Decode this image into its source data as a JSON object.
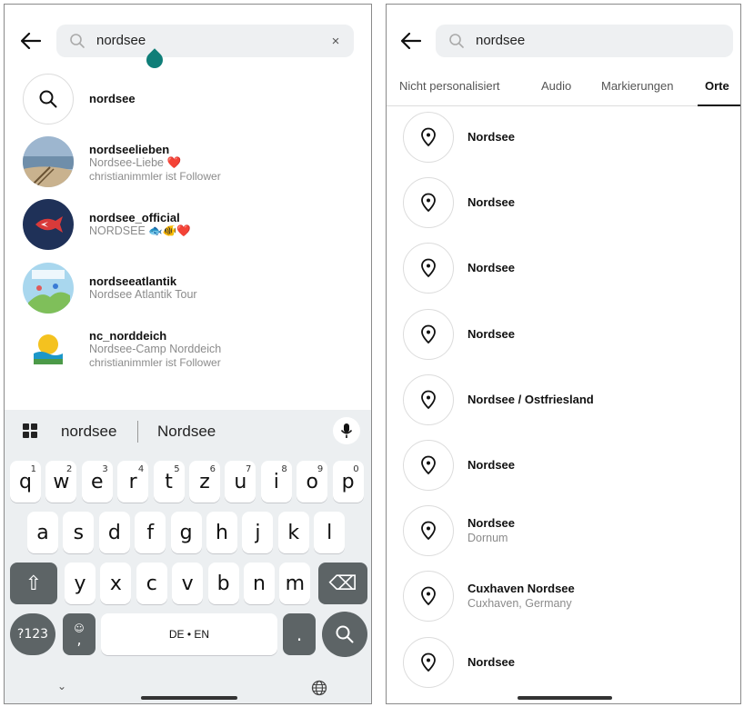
{
  "left": {
    "search": {
      "query": "nordsee",
      "clear": "×"
    },
    "results": [
      {
        "title": "nordsee"
      },
      {
        "title": "nordseelieben",
        "sub": "Nordsee-Liebe ❤️",
        "sub2": "christianimmler ist Follower"
      },
      {
        "title": "nordsee_official",
        "sub": "NORDSEE 🐟🐠❤️"
      },
      {
        "title": "nordseeatlantik",
        "sub": "Nordsee Atlantik Tour"
      },
      {
        "title": "nc_norddeich",
        "sub": "Nordsee-Camp Norddeich",
        "sub2": "christianimmler ist Follower"
      }
    ],
    "keyboard": {
      "suggestions": [
        "nordsee",
        "Nordsee"
      ],
      "row1": [
        "q",
        "w",
        "e",
        "r",
        "t",
        "z",
        "u",
        "i",
        "o",
        "p"
      ],
      "row1_hints": [
        "1",
        "2",
        "3",
        "4",
        "5",
        "6",
        "7",
        "8",
        "9",
        "0"
      ],
      "row2": [
        "a",
        "s",
        "d",
        "f",
        "g",
        "h",
        "j",
        "k",
        "l"
      ],
      "row3": [
        "y",
        "x",
        "c",
        "v",
        "b",
        "n",
        "m"
      ],
      "shift": "⇧",
      "backspace": "⌫",
      "symbols": "?123",
      "emoji_hint": "☺",
      "comma": ",",
      "space": "DE • EN",
      "period": ".",
      "nav_hide": "⌄"
    }
  },
  "right": {
    "search": {
      "query": "nordsee"
    },
    "tabs": [
      "Nicht personalisiert",
      "Audio",
      "Markierungen",
      "Orte"
    ],
    "active_tab": "Orte",
    "places": [
      {
        "title": "Nordsee"
      },
      {
        "title": "Nordsee"
      },
      {
        "title": "Nordsee"
      },
      {
        "title": "Nordsee"
      },
      {
        "title": "Nordsee / Ostfriesland"
      },
      {
        "title": "Nordsee"
      },
      {
        "title": "Nordsee",
        "sub": "Dornum"
      },
      {
        "title": "Cuxhaven Nordsee",
        "sub": "Cuxhaven, Germany"
      },
      {
        "title": "Nordsee"
      }
    ]
  },
  "colors": {
    "search_bg": "#eef0f2",
    "keyboard_bg": "#eceff1",
    "dark_key": "#5d6466",
    "secondary_text": "#8b8b8b",
    "caret": "#0f7e78"
  }
}
